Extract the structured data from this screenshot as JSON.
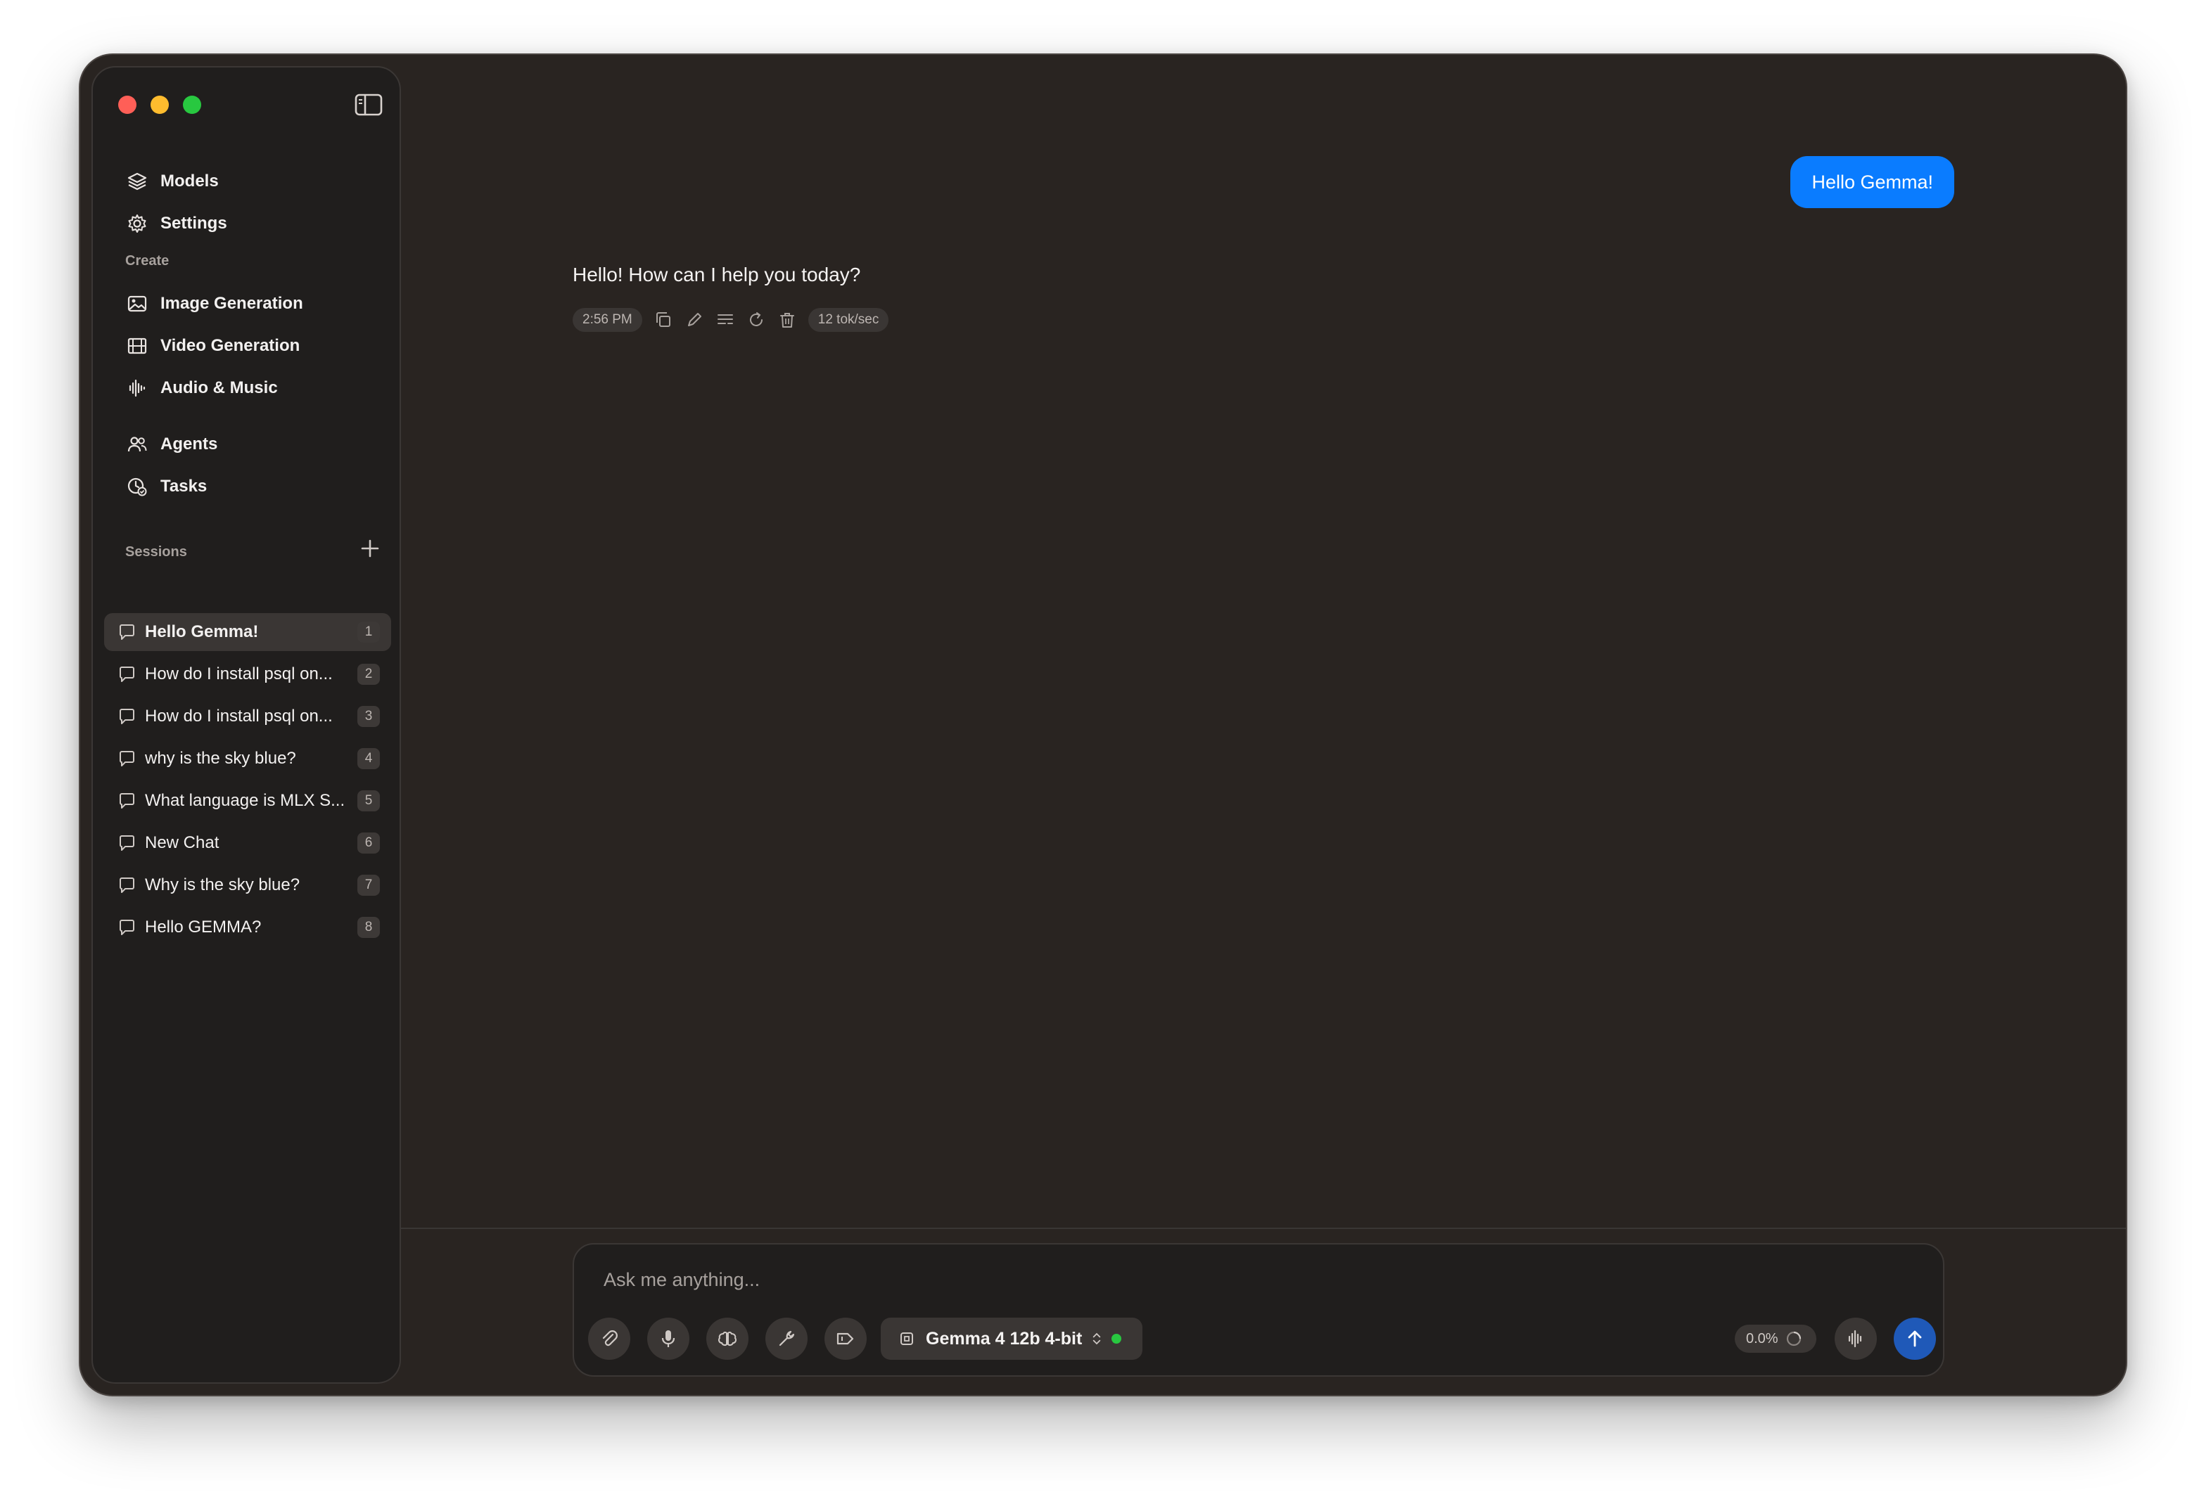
{
  "colors": {
    "accent": "#0a7cff",
    "send": "#1f59b8",
    "status_online": "#28c840",
    "window_bg": "#292421",
    "sidebar_bg": "#201e1d"
  },
  "sidebar": {
    "nav": [
      {
        "label": "Models",
        "icon": "layers-icon"
      },
      {
        "label": "Settings",
        "icon": "gear-icon"
      }
    ],
    "create_label": "Create",
    "create_items": [
      {
        "label": "Image Generation",
        "icon": "image-icon"
      },
      {
        "label": "Video Generation",
        "icon": "film-icon"
      },
      {
        "label": "Audio & Music",
        "icon": "waveform-icon"
      }
    ],
    "other_items": [
      {
        "label": "Agents",
        "icon": "people-icon"
      },
      {
        "label": "Tasks",
        "icon": "clock-check-icon"
      }
    ],
    "sessions_label": "Sessions",
    "sessions": [
      {
        "title": "Hello Gemma!",
        "badge": "1",
        "active": true
      },
      {
        "title": "How do I install psql on...",
        "badge": "2"
      },
      {
        "title": "How do I install psql on...",
        "badge": "3"
      },
      {
        "title": "why is the sky blue?",
        "badge": "4"
      },
      {
        "title": "What language is MLX S...",
        "badge": "5"
      },
      {
        "title": "New Chat",
        "badge": "6"
      },
      {
        "title": "Why is the sky blue?",
        "badge": "7"
      },
      {
        "title": "Hello GEMMA?",
        "badge": "8"
      }
    ]
  },
  "chat": {
    "user_message": "Hello Gemma!",
    "assistant_message": "Hello! How can I help you today?",
    "timestamp": "2:56 PM",
    "speed": "12 tok/sec"
  },
  "composer": {
    "placeholder": "Ask me anything...",
    "model": "Gemma 4 12b 4-bit",
    "usage": "0.0%"
  }
}
